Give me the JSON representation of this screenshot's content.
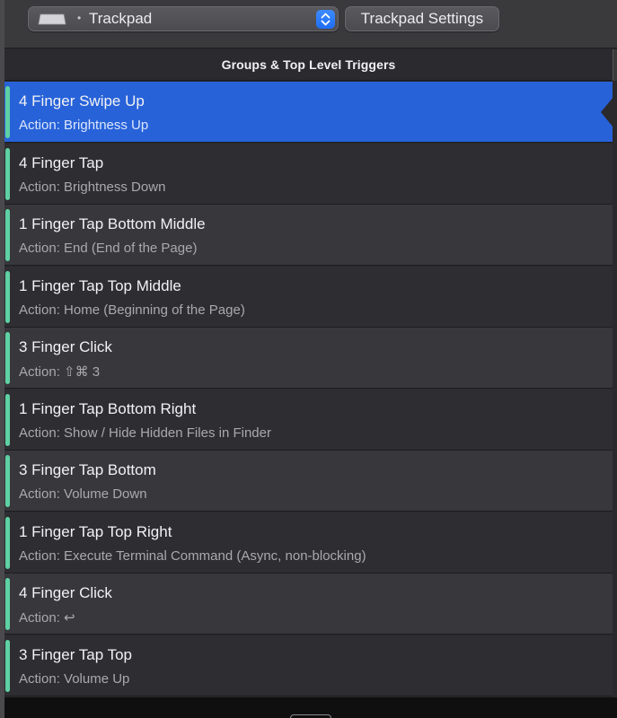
{
  "toolbar": {
    "device_selector": {
      "icon": "trackpad-icon",
      "bullet": "•",
      "label": "Trackpad"
    },
    "settings_button": "Trackpad Settings"
  },
  "section": {
    "title": "Groups & Top Level Triggers"
  },
  "triggers": [
    {
      "name": "4 Finger Swipe Up",
      "action": "Action: Brightness Up",
      "selected": true
    },
    {
      "name": "4 Finger Tap",
      "action": "Action: Brightness Down"
    },
    {
      "name": "1 Finger Tap Bottom Middle",
      "action": "Action: End (End of the Page)"
    },
    {
      "name": "1 Finger Tap Top Middle",
      "action": "Action: Home (Beginning of the Page)"
    },
    {
      "name": "3 Finger Click",
      "action": "Action: ⇧⌘ 3"
    },
    {
      "name": "1 Finger Tap Bottom Right",
      "action": "Action: Show / Hide Hidden Files in Finder"
    },
    {
      "name": "3 Finger Tap Bottom",
      "action": "Action: Volume Down"
    },
    {
      "name": "1 Finger Tap Top Right",
      "action": "Action: Execute Terminal Command (Async, non-blocking)"
    },
    {
      "name": "4 Finger Click",
      "action": "Action:  ↩"
    },
    {
      "name": "3 Finger Tap Top",
      "action": "Action: Volume Up"
    }
  ],
  "colors": {
    "selection": "#2762d9",
    "accent_bar": "#5fd1a4",
    "row_dark": "#2e2d31",
    "row_light": "#38373b"
  }
}
